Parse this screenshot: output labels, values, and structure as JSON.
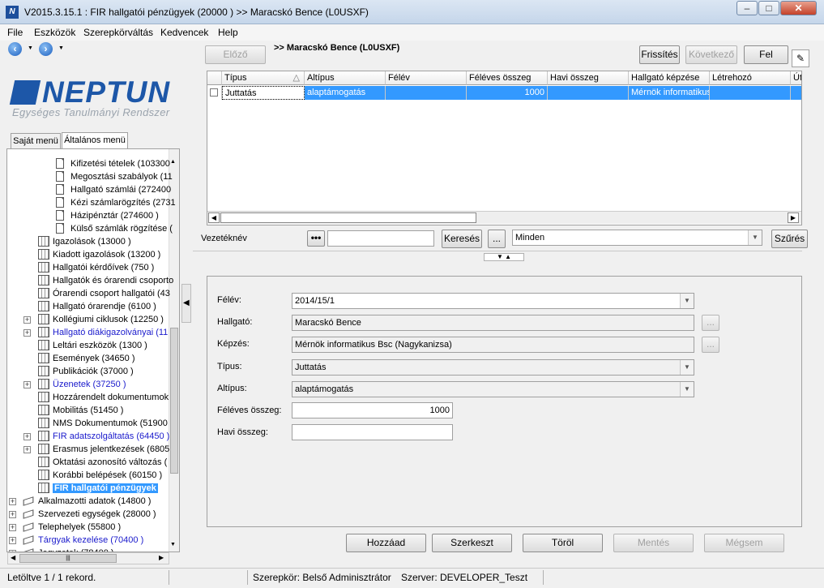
{
  "window": {
    "title": "V2015.3.15.1 : FIR hallgatói pénzügyek (20000  )  >> Maracskó Bence (L0USXF)"
  },
  "menu": [
    "File",
    "Eszközök",
    "Szerepkörváltás",
    "Kedvencek",
    "Help"
  ],
  "logo": {
    "text": "NEPTUN",
    "tagline": "Egységes Tanulmányi Rendszer"
  },
  "tabs": [
    "Saját menü",
    "Általános menü"
  ],
  "tree": [
    {
      "label": "Kifizetési tételek (103300",
      "icon": "doc-icon",
      "indent": 3
    },
    {
      "label": "Megosztási szabályok (11",
      "icon": "doc-icon",
      "indent": 3
    },
    {
      "label": "Hallgató számlái (272400",
      "icon": "doc-icon",
      "indent": 3
    },
    {
      "label": "Kézi számlarögzítés (2731",
      "icon": "doc-icon",
      "indent": 3
    },
    {
      "label": "Házipénztár (274600  )",
      "icon": "doc-icon",
      "indent": 3
    },
    {
      "label": "Külső számlák rögzítése (",
      "icon": "doc-icon",
      "indent": 3
    },
    {
      "label": "Igazolások (13000  )",
      "icon": "grid-icon",
      "indent": 2
    },
    {
      "label": "Kiadott igazolások (13200  )",
      "icon": "grid-icon",
      "indent": 2
    },
    {
      "label": "Hallgatói kérdőívek (750  )",
      "icon": "grid-icon",
      "indent": 2
    },
    {
      "label": "Hallgatók és órarendi csoporto",
      "icon": "grid-icon",
      "indent": 2
    },
    {
      "label": "Órarendi csoport hallgatói (43",
      "icon": "grid-icon",
      "indent": 2
    },
    {
      "label": "Hallgató órarendje (6100  )",
      "icon": "grid-icon",
      "indent": 2
    },
    {
      "label": "Kollégiumi ciklusok (12250  )",
      "icon": "grid-icon",
      "indent": 2,
      "expand": true
    },
    {
      "label": "Hallgató diákigazolványai (11",
      "icon": "grid-icon",
      "indent": 2,
      "expand": true,
      "blue": true
    },
    {
      "label": "Leltári eszközök (1300  )",
      "icon": "grid-icon",
      "indent": 2
    },
    {
      "label": "Események (34650  )",
      "icon": "grid-icon",
      "indent": 2
    },
    {
      "label": "Publikációk (37000  )",
      "icon": "grid-icon",
      "indent": 2
    },
    {
      "label": "Üzenetek (37250  )",
      "icon": "grid-icon",
      "indent": 2,
      "expand": true,
      "blue": true
    },
    {
      "label": "Hozzárendelt dokumentumok",
      "icon": "grid-icon",
      "indent": 2
    },
    {
      "label": "Mobilitás (51450  )",
      "icon": "grid-icon",
      "indent": 2
    },
    {
      "label": "NMS Dokumentumok (51900",
      "icon": "grid-icon",
      "indent": 2
    },
    {
      "label": "FIR adatszolgáltatás (64450  )",
      "icon": "grid-icon",
      "indent": 2,
      "expand": true,
      "blue": true
    },
    {
      "label": "Erasmus jelentkezések (6805",
      "icon": "grid-icon",
      "indent": 2,
      "expand": true
    },
    {
      "label": "Oktatási azonosító változás (",
      "icon": "grid-icon",
      "indent": 2
    },
    {
      "label": "Korábbi belépések (60150  )",
      "icon": "grid-icon",
      "indent": 2
    },
    {
      "label": "FIR hallgatói pénzügyek",
      "icon": "grid-icon",
      "indent": 2,
      "selected": true
    },
    {
      "label": "Alkalmazotti adatok (14800  )",
      "icon": "book-icon",
      "indent": 0,
      "expand": true
    },
    {
      "label": "Szervezeti egységek (28000  )",
      "icon": "book-icon",
      "indent": 0,
      "expand": true
    },
    {
      "label": "Telephelyek (55800  )",
      "icon": "book-icon",
      "indent": 0,
      "expand": true
    },
    {
      "label": "Tárgyak kezelése (70400  )",
      "icon": "book-icon",
      "indent": 0,
      "expand": true,
      "blue": true
    },
    {
      "label": "Jegyzetek (78400  )",
      "icon": "book-icon",
      "indent": 0,
      "expand": true
    }
  ],
  "toolbar": {
    "prev": "Előző",
    "record_title": ">> Maracskó Bence (L0USXF)",
    "refresh": "Frissítés",
    "next": "Következő",
    "up": "Fel"
  },
  "grid": {
    "columns": [
      "Típus",
      "Altípus",
      "Félév",
      "Féléves összeg",
      "Havi összeg",
      "Hallgató képzése",
      "Létrehozó",
      "Út"
    ],
    "rows": [
      [
        "Juttatás",
        "alaptámogatás",
        "",
        "1000",
        "",
        "Mérnök informatikus",
        "",
        ""
      ]
    ]
  },
  "search": {
    "label": "Vezetéknév",
    "value": "",
    "button": "Keresés",
    "ellipsis": "...",
    "filter": "Minden",
    "filter_button": "Szűrés"
  },
  "form": {
    "felev_label": "Félév:",
    "felev": "2014/15/1",
    "hallgato_label": "Hallgató:",
    "hallgato": "Maracskó Bence",
    "kepzes_label": "Képzés:",
    "kepzes": "Mérnök informatikus Bsc (Nagykanizsa)",
    "tipus_label": "Típus:",
    "tipus": "Juttatás",
    "altipus_label": "Altípus:",
    "altipus": "alaptámogatás",
    "feleves_label": "Féléves összeg:",
    "feleves": "1000",
    "havi_label": "Havi összeg:",
    "havi": "",
    "dots": "..."
  },
  "actions": {
    "add": "Hozzáad",
    "edit": "Szerkeszt",
    "delete": "Töröl",
    "save": "Mentés",
    "cancel": "Mégsem"
  },
  "status": {
    "records": "Letöltve 1 / 1 rekord.",
    "role": "Szerepkör: Belső Adminisztrátor",
    "server": "Szerver: DEVELOPER_Teszt"
  }
}
